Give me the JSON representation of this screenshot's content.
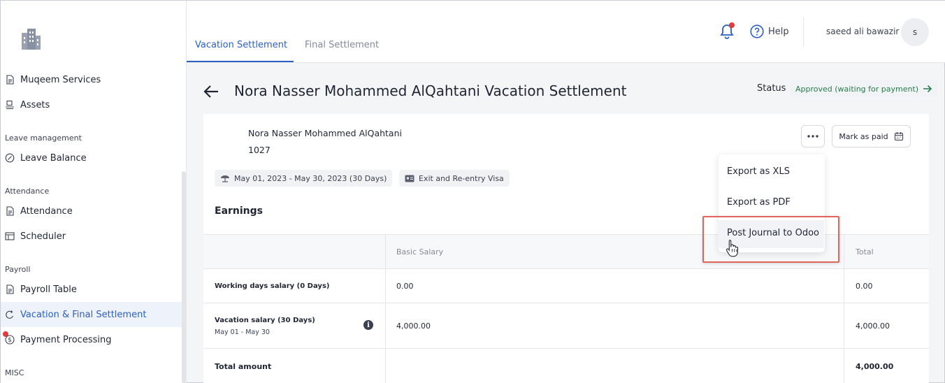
{
  "sidebar": {
    "items": [
      {
        "label": "Muqeem Services",
        "icon": "document-icon"
      },
      {
        "label": "Assets",
        "icon": "assets-icon"
      },
      {
        "label": "Leave Balance",
        "icon": "leave-icon"
      },
      {
        "label": "Attendance",
        "icon": "document-icon"
      },
      {
        "label": "Scheduler",
        "icon": "table-icon"
      },
      {
        "label": "Payroll Table",
        "icon": "document-icon"
      },
      {
        "label": "Vacation & Final Settlement",
        "icon": "settlement-icon"
      },
      {
        "label": "Payment Processing",
        "icon": "dollar-icon"
      }
    ],
    "sections": {
      "leave": "Leave management",
      "attendance": "Attendance",
      "payroll": "Payroll",
      "misc": "MISC"
    }
  },
  "tabs": [
    {
      "label": "Vacation Settlement",
      "active": true
    },
    {
      "label": "Final Settlement",
      "active": false
    }
  ],
  "header": {
    "help": "Help",
    "user_name": "saeed ali bawazir",
    "avatar_initial": "s"
  },
  "page": {
    "title": "Nora Nasser Mohammed AlQahtani Vacation Settlement",
    "status_label": "Status",
    "status_value": "Approved (waiting for payment)"
  },
  "employee": {
    "name": "Nora Nasser Mohammed AlQahtani",
    "id": "1027"
  },
  "actions": {
    "mark_paid": "Mark as paid"
  },
  "chips": {
    "period": "May 01, 2023 - May 30, 2023 (30 Days)",
    "visa": "Exit and Re-entry Visa"
  },
  "earnings": {
    "title": "Earnings",
    "columns": [
      "",
      "Basic Salary",
      "Total"
    ],
    "rows": [
      {
        "label": "Working days salary (0 Days)",
        "sub": "",
        "basic": "0.00",
        "total": "0.00"
      },
      {
        "label": "Vacation salary (30 Days)",
        "sub": "May 01 - May 30",
        "basic": "4,000.00",
        "total": "4,000.00"
      },
      {
        "label": "Total amount",
        "sub": "",
        "basic": "",
        "total": "4,000.00"
      }
    ]
  },
  "dropdown": {
    "items": [
      "Export as XLS",
      "Export as PDF",
      "Post Journal to Odoo"
    ]
  },
  "colors": {
    "accent": "#2b5fc6",
    "status_green": "#2a7a4b",
    "notification_red": "#e23b3b",
    "highlight_border": "#e0645a"
  }
}
